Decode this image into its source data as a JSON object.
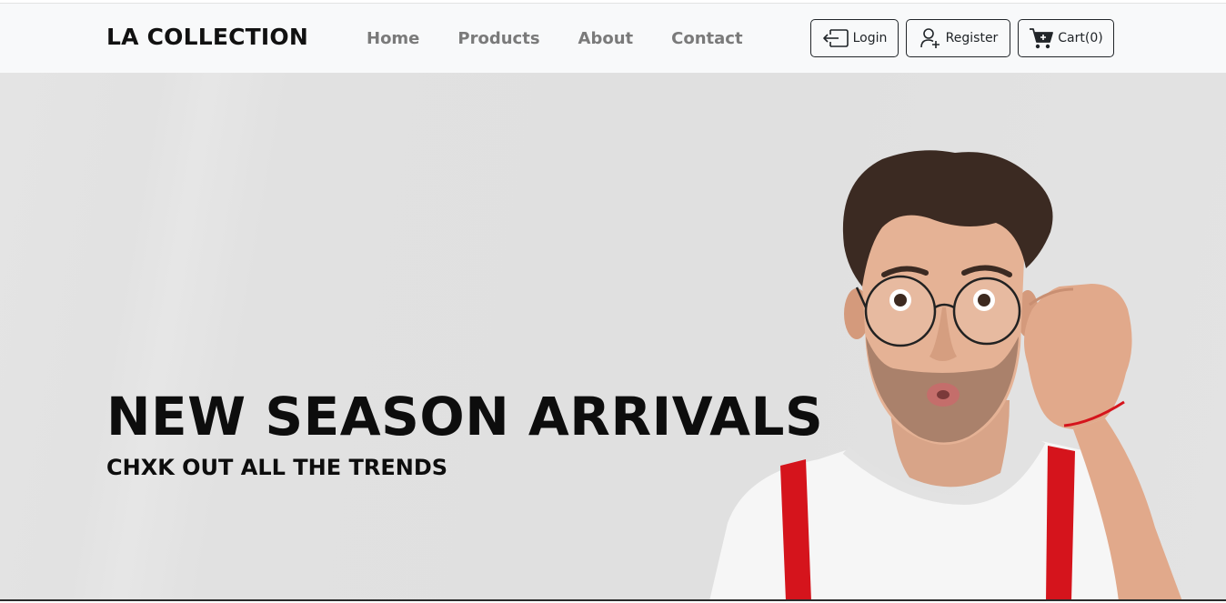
{
  "navbar": {
    "brand": "LA COLLECTION",
    "links": [
      {
        "label": "Home"
      },
      {
        "label": "Products"
      },
      {
        "label": "About"
      },
      {
        "label": "Contact"
      }
    ],
    "actions": {
      "login_label": "Login",
      "register_label": "Register",
      "cart_label": "Cart(0)",
      "login_icon": "box-arrow-in-left-icon",
      "register_icon": "person-add-icon",
      "cart_icon": "cart-plus-icon"
    }
  },
  "hero": {
    "title": "NEW SEASON ARRIVALS",
    "subtitle": "CHXK OUT ALL THE TRENDS",
    "image": "surprised-man-adjusting-glasses-photo"
  },
  "colors": {
    "navbar_bg": "#f8f9fa",
    "hero_bg": "#e1e1e1",
    "nav_link": "#7a7a7a",
    "text_dark": "#0d0d0d",
    "suspender_red": "#d5141c"
  }
}
